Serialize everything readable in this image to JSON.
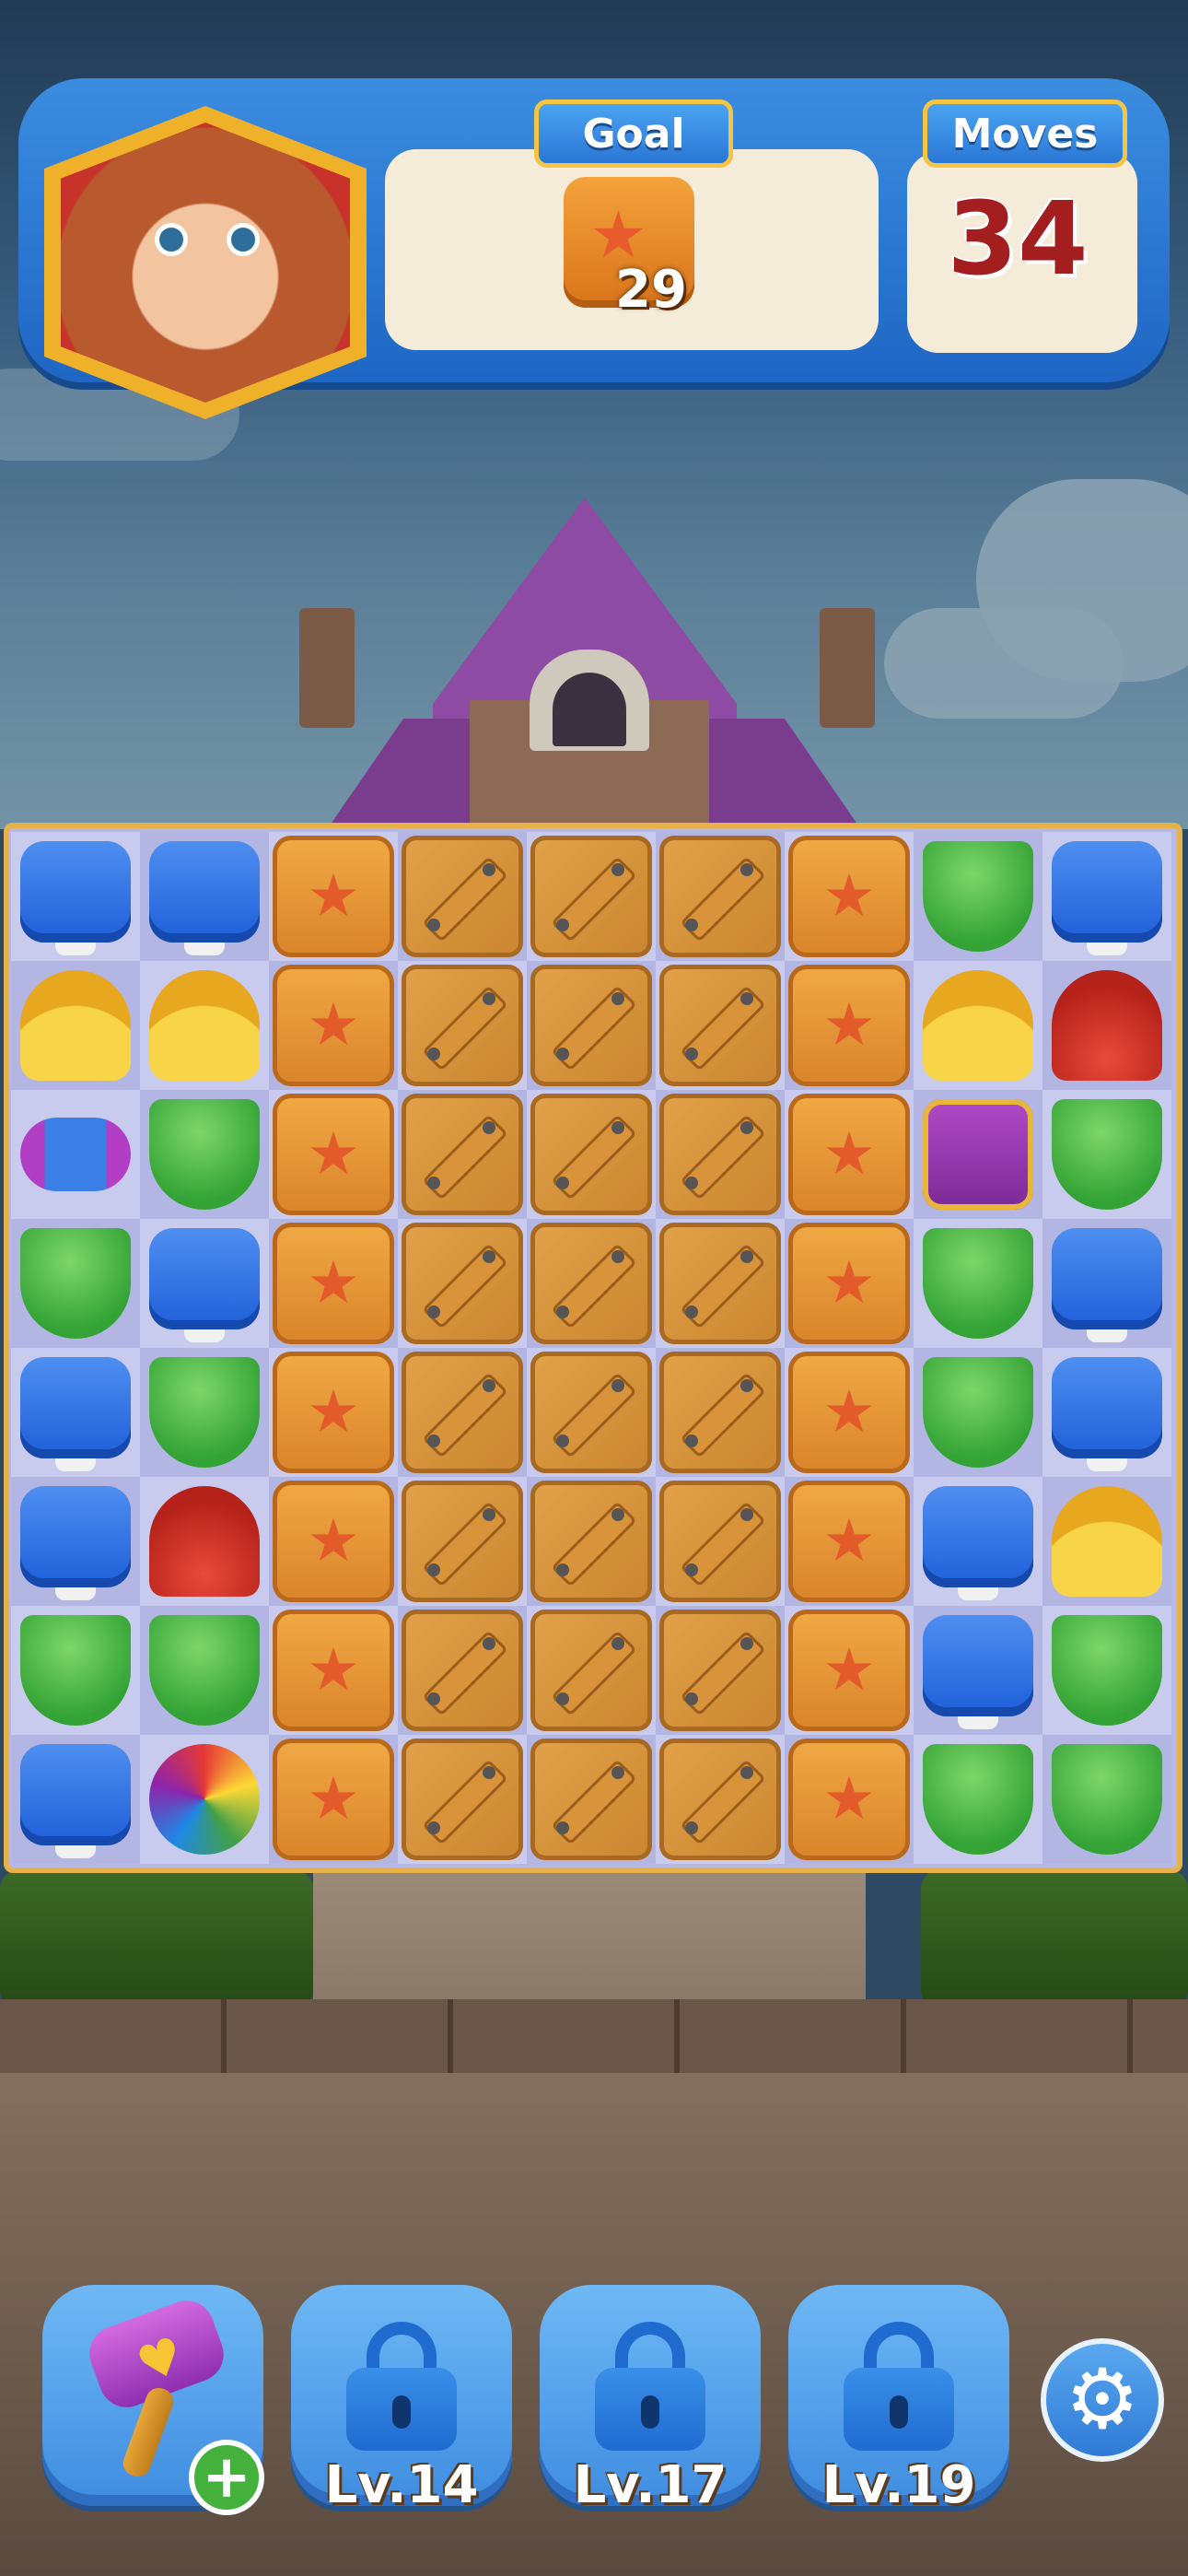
{
  "hud": {
    "goal_label": "Goal",
    "goal_count": "29",
    "goal_icon": "star-crate-icon",
    "moves_label": "Moves",
    "moves_value": "34"
  },
  "board": {
    "rows": [
      [
        "blue",
        "blue",
        "crate",
        "plank",
        "plank",
        "plank",
        "crate",
        "cup",
        "blue"
      ],
      [
        "shell",
        "shell",
        "crate",
        "plank",
        "plank",
        "plank",
        "crate",
        "shell",
        "hat"
      ],
      [
        "rocket",
        "cup",
        "crate",
        "plank",
        "plank",
        "plank",
        "crate",
        "dynamite",
        "cup"
      ],
      [
        "cup",
        "blue",
        "crate",
        "plank",
        "plank",
        "plank",
        "crate",
        "cup",
        "blue"
      ],
      [
        "blue",
        "cup",
        "crate",
        "plank",
        "plank",
        "plank",
        "crate",
        "cup",
        "blue"
      ],
      [
        "blue",
        "hat",
        "crate",
        "plank",
        "plank",
        "plank",
        "crate",
        "blue",
        "shell"
      ],
      [
        "cup",
        "cup",
        "crate",
        "plank",
        "plank",
        "plank",
        "crate",
        "blue",
        "cup"
      ],
      [
        "blue",
        "ball",
        "crate",
        "plank",
        "plank",
        "plank",
        "crate",
        "cup",
        "cup"
      ]
    ]
  },
  "boosters": [
    {
      "icon": "hammer-icon",
      "locked": false,
      "label": ""
    },
    {
      "icon": "lock-icon",
      "locked": true,
      "label": "Lv.14"
    },
    {
      "icon": "lock-icon",
      "locked": true,
      "label": "Lv.17"
    },
    {
      "icon": "lock-icon",
      "locked": true,
      "label": "Lv.19"
    }
  ],
  "settings_icon": "gear-icon",
  "colors": {
    "hud_blue": "#1f66c4",
    "moves_red": "#a31f1f",
    "board_border": "#e7b24a"
  }
}
